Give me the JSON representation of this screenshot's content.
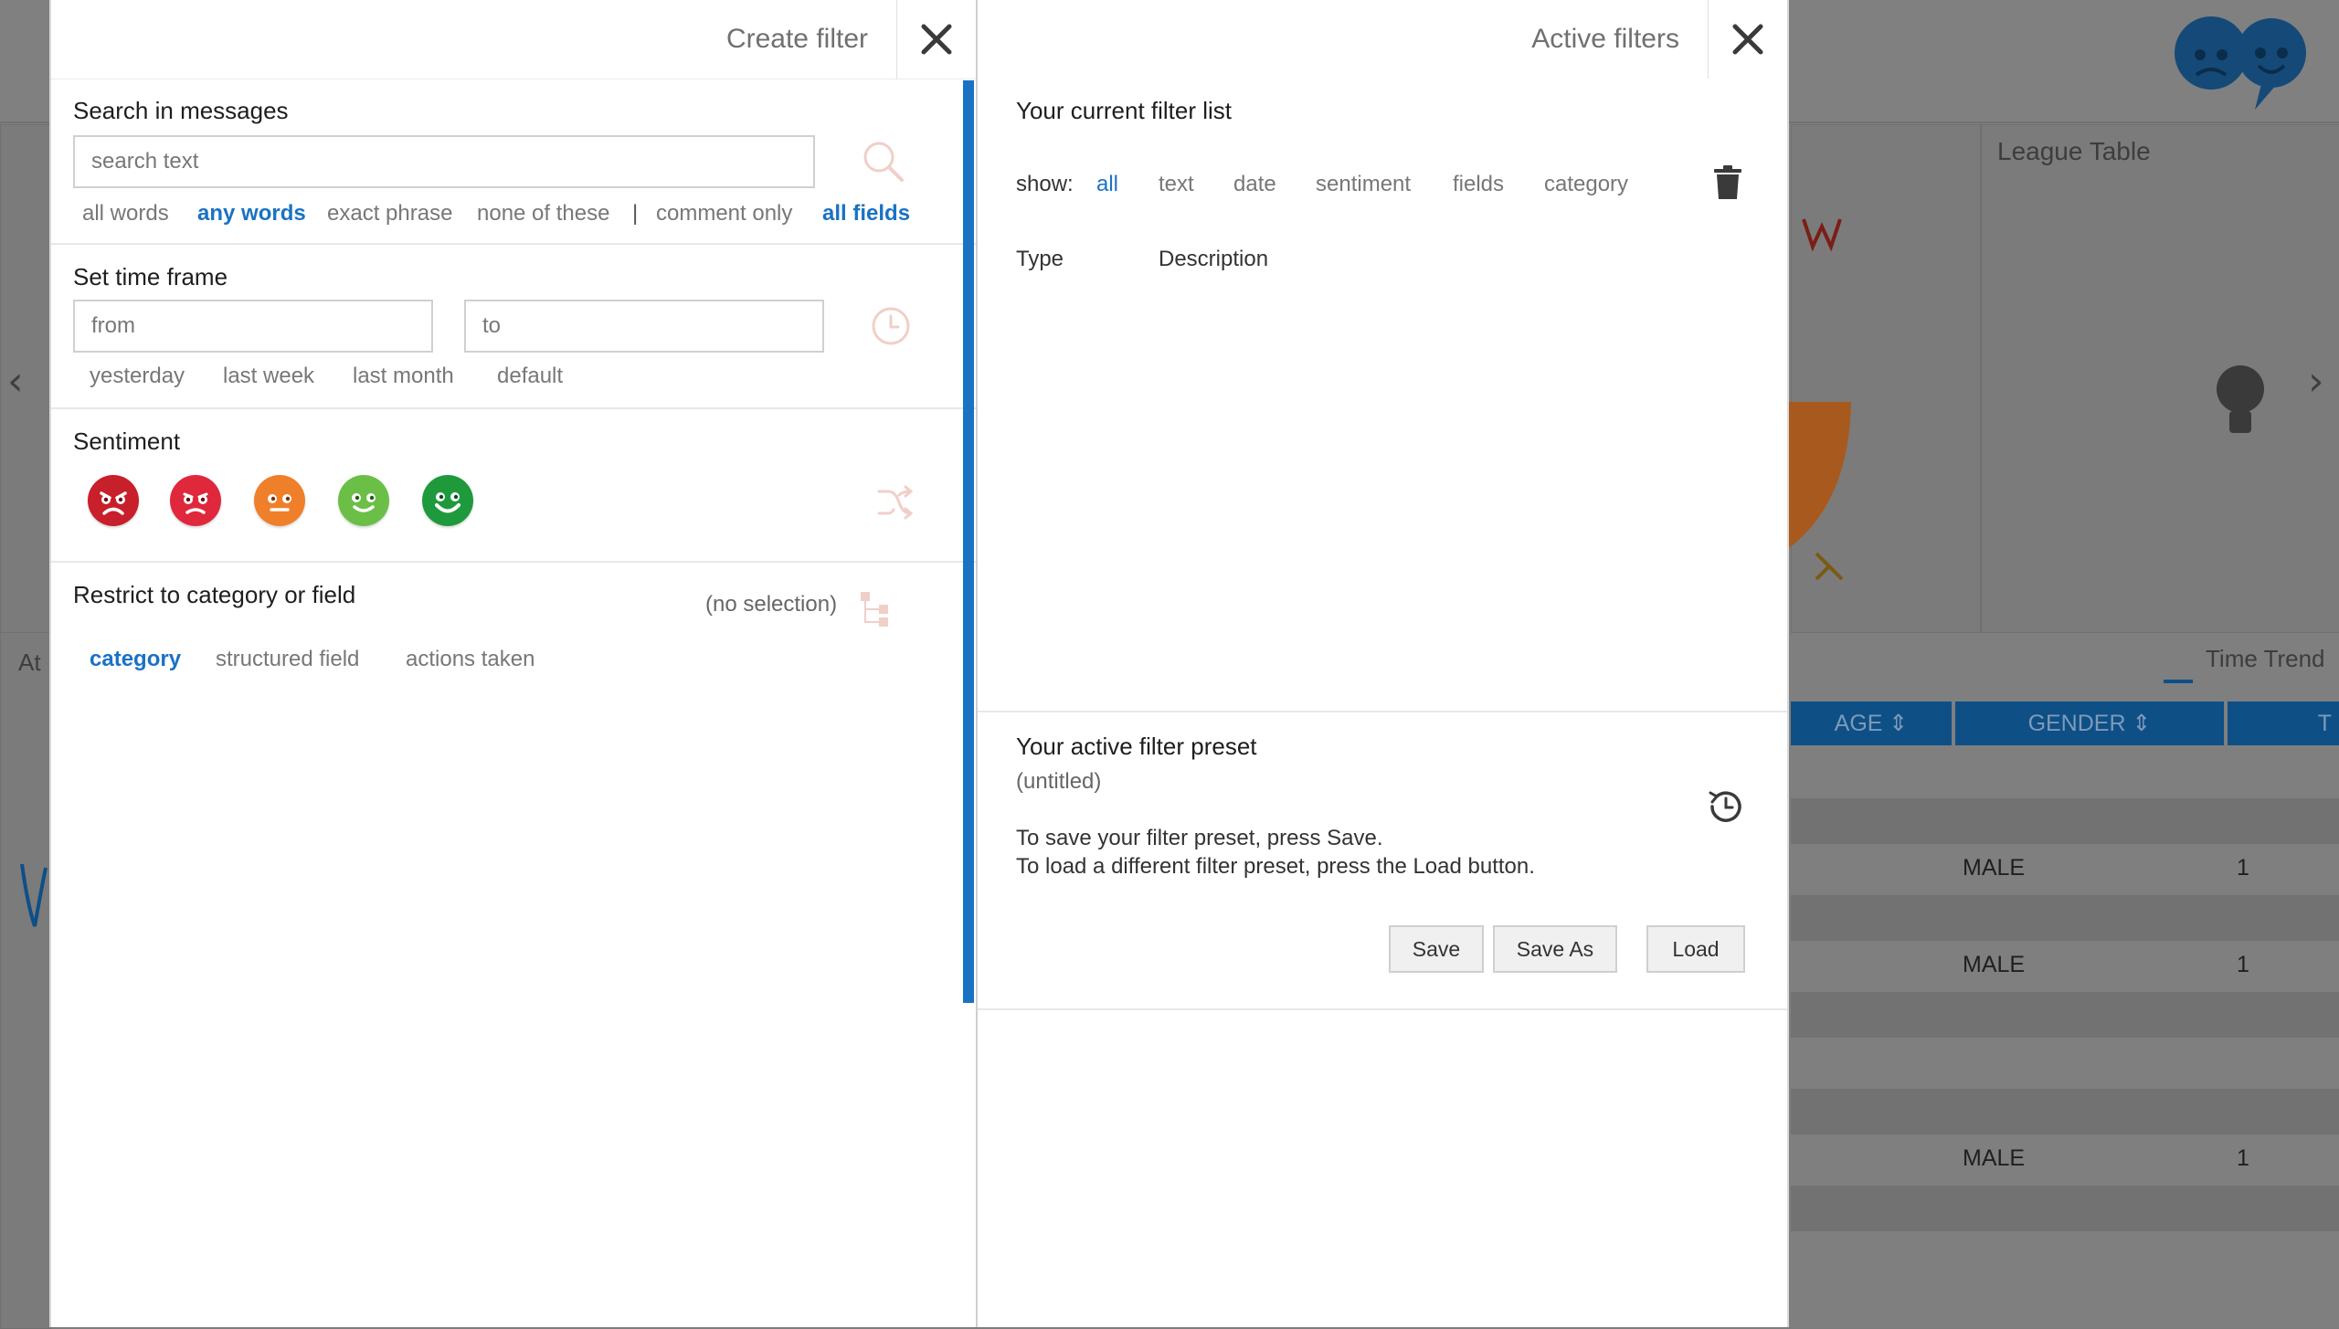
{
  "background": {
    "league_table": "League Table",
    "time_trend": "Time Trend",
    "at_label": "At",
    "table_headers": [
      "AGE",
      "GENDER",
      "T"
    ],
    "rows": [
      {
        "gender": "",
        "count": ""
      },
      {
        "gender": "MALE",
        "count": "1"
      },
      {
        "gender": "",
        "count": ""
      },
      {
        "gender": "MALE",
        "count": "1"
      },
      {
        "gender": "",
        "count": ""
      },
      {
        "gender": "",
        "count": ""
      },
      {
        "gender": "",
        "count": ""
      },
      {
        "gender": "MALE",
        "count": "1"
      },
      {
        "gender": "",
        "count": ""
      }
    ],
    "sort_glyph": "⇕"
  },
  "create_filter": {
    "title": "Create filter",
    "search": {
      "title": "Search in messages",
      "placeholder": "search text",
      "options": [
        "all words",
        "any words",
        "exact phrase",
        "none of these"
      ],
      "separator": "|",
      "scope": [
        "comment only",
        "all fields"
      ]
    },
    "time": {
      "title": "Set time frame",
      "from_placeholder": "from",
      "to_placeholder": "to",
      "presets": [
        "yesterday",
        "last week",
        "last month",
        "default"
      ]
    },
    "sentiment": {
      "title": "Sentiment",
      "faces": [
        {
          "name": "very-negative",
          "color": "#c8202a"
        },
        {
          "name": "negative",
          "color": "#e0283d"
        },
        {
          "name": "neutral",
          "color": "#f07f2a"
        },
        {
          "name": "positive",
          "color": "#6bbf47"
        },
        {
          "name": "very-positive",
          "color": "#1e9a3d"
        }
      ]
    },
    "category": {
      "title": "Restrict to category or field",
      "selection": "(no selection)",
      "tabs": [
        "category",
        "structured field",
        "actions taken"
      ]
    }
  },
  "active_filters": {
    "title": "Active filters",
    "list_title": "Your current filter list",
    "show_label": "show:",
    "show_options": [
      "all",
      "text",
      "date",
      "sentiment",
      "fields",
      "category"
    ],
    "columns": [
      "Type",
      "Description"
    ],
    "preset": {
      "title": "Your active filter preset",
      "name": "(untitled)",
      "help_line1": "To save your filter preset, press Save.",
      "help_line2": "To load a different filter preset, press the Load button.",
      "buttons": [
        "Save",
        "Save As",
        "Load"
      ]
    }
  },
  "colors": {
    "accent": "#1a72c4",
    "muted_text": "#777777"
  }
}
